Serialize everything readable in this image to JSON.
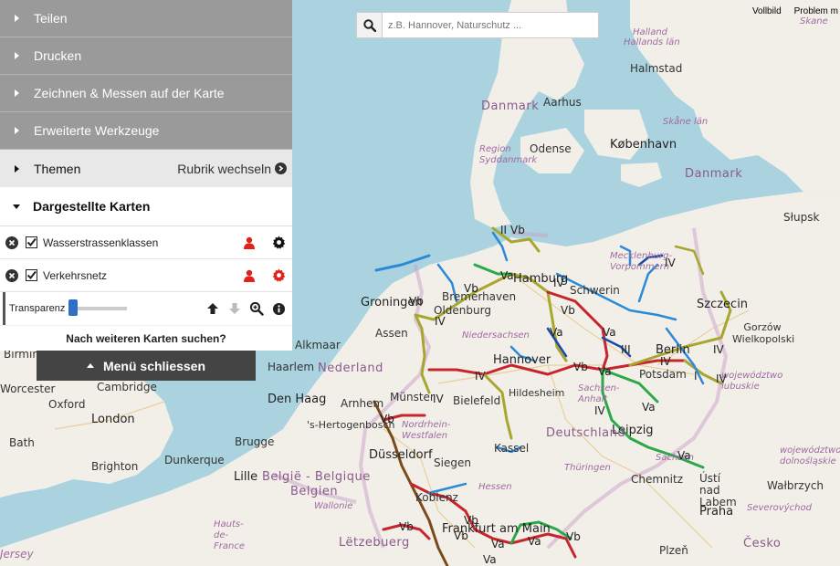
{
  "top_links": [
    "Vollbild",
    "Problem m"
  ],
  "search": {
    "placeholder": "z.B. Hannover, Naturschutz ..."
  },
  "menu": {
    "items": [
      {
        "label": "Teilen"
      },
      {
        "label": "Drucken"
      },
      {
        "label": "Zeichnen & Messen auf der Karte"
      },
      {
        "label": "Erweiterte Werkzeuge"
      }
    ],
    "themen_label": "Themen",
    "rubrik_label": "Rubrik wechseln",
    "dargestellte_label": "Dargestellte Karten",
    "layers": [
      {
        "name": "Wasserstrassenklassen",
        "checked": true
      },
      {
        "name": "Verkehrsnetz",
        "checked": true
      }
    ],
    "transparency_label": "Transparenz",
    "more_maps_label": "Nach weiteren Karten suchen?",
    "close_label": "Menü schliessen"
  },
  "map_labels": {
    "cities": [
      "Halmstad",
      "Aarhus",
      "Odense",
      "København",
      "Hamburg",
      "Bremerhaven",
      "Oldenburg",
      "Bremen",
      "Schwerin",
      "Szczecin",
      "Hannover",
      "Berlin",
      "Potsdam",
      "Magdeburg",
      "Leipzig",
      "Bielefeld",
      "Münster",
      "Düsseldorf",
      "Arnhem",
      "Den Haag",
      "Groningen",
      "Assen",
      "Alkmaar",
      "Haarlem",
      "Kassel",
      "Siegen",
      "Koblenz",
      "Frankfurt am Main",
      "Chemnitz",
      "Ústí nad Labem",
      "Praha",
      "Plzeň",
      "Cambridge",
      "London",
      "Oxford",
      "Worcester",
      "Brighton",
      "Lille",
      "Brugge",
      "Dunkerque",
      "Bath",
      "Gorzów Wielkopolski",
      "Wałbrzych",
      "Słupsk",
      "'s-Hertogenbosch",
      "Hildesheim",
      "Birmingham"
    ],
    "countries": [
      "Danmark",
      "Danmark",
      "Nederland",
      "Deutschland",
      "België - Belgique",
      "Belgien",
      "Lëtzebuerg",
      "Česko"
    ],
    "regions": [
      "Halland",
      "Hallands län",
      "Skåne län",
      "Skane",
      "Region Syddanmark",
      "Mecklenburg-Vorpommern",
      "Niedersachsen",
      "Sachsen-Anhalt",
      "Nordrhein-Westfalen",
      "Hessen",
      "Thüringen",
      "Sachsen",
      "Wallonie",
      "Hauts-de-France",
      "województwo lubuskie",
      "województwo dolnośląskie",
      "Severovýchod",
      "Jersey"
    ],
    "waterway_classes": [
      "Vb",
      "Vb",
      "Va",
      "IV",
      "IV",
      "Vb",
      "IV",
      "IV",
      "Vb",
      "Va",
      "Va",
      "Va",
      "IV",
      "Vb",
      "Va",
      "III",
      "IV",
      "IV",
      "IV",
      "Va",
      "IV",
      "Vb",
      "Vb",
      "Vb",
      "Va",
      "Vb",
      "Vb",
      "Va",
      "Va",
      "II",
      "I"
    ]
  },
  "colors": {
    "menu_gray": "#9a9a9a",
    "themen_bg": "#e8e8e8",
    "close_btn": "#444444",
    "user_icon_red": "#e0221b",
    "gear_red": "#e0221b",
    "slider_blue": "#2f6fc6",
    "waterway_red": "#c8242c",
    "waterway_olive": "#a7a62e",
    "waterway_green": "#2aa84a",
    "waterway_blue": "#2a8ad8",
    "waterway_brown": "#7a4a1a",
    "sea": "#aad3df",
    "land": "#f2efe9"
  }
}
